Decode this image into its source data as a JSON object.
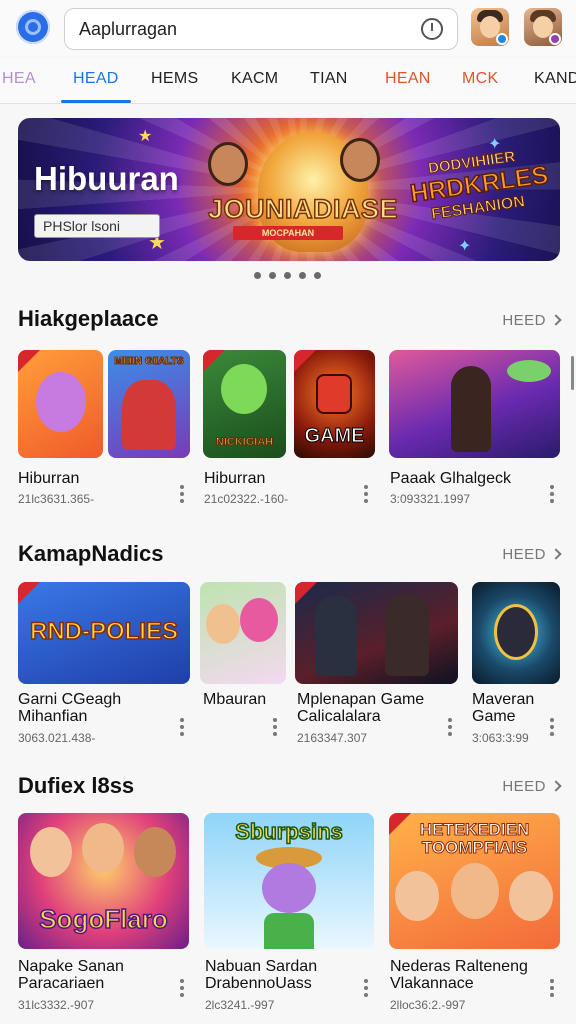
{
  "header": {
    "search_value": "Aaplurragan"
  },
  "tabs": [
    "HEA",
    "HEAD",
    "HEMS",
    "KACM",
    "TIAN",
    "HEAN",
    "MCK",
    "KAND"
  ],
  "hero": {
    "title": "Hibuuran",
    "chip": "PHSlor lsoni",
    "center_word": "JOUNIADIASE",
    "ribbon": "MOCPAHAN",
    "promo_line1": "DODVIHIIER",
    "promo_line2": "HRDKRLES",
    "promo_line3": "FESHANION",
    "carousel_count": 5
  },
  "sections": [
    {
      "title": "Hiakgeplaace",
      "more": "HEED",
      "cards": [
        {
          "art_label": "",
          "name": "Hiburran",
          "meta": "21lc3631.365-"
        },
        {
          "art_label": "MEIIN GIIALTS",
          "name": "",
          "meta": ""
        },
        {
          "art_label": "NICKIGIAH",
          "name": "Hiburran",
          "meta": "21c02322.-160-"
        },
        {
          "art_label": "GAME",
          "name": "",
          "meta": ""
        },
        {
          "art_label": "",
          "name": "Paaak Glhalgeck",
          "meta": "3:093321.1997"
        }
      ]
    },
    {
      "title": "KamapNadics",
      "more": "HEED",
      "cards": [
        {
          "art_label": "RND-POLIES",
          "name": "Garni CGeagh\nMihanfian",
          "meta": "3063.021.438-"
        },
        {
          "art_label": "",
          "name": "Mbauran",
          "meta": ""
        },
        {
          "art_label": "",
          "name": "Mplenapan Game\nCalicalalara",
          "meta": "2163347.307"
        },
        {
          "art_label": "",
          "name": "Maveran\nGame",
          "meta": "3:063:3:99"
        }
      ]
    },
    {
      "title": "Dufiex l8ss",
      "more": "HEED",
      "cards": [
        {
          "art_label": "SogoFlaro",
          "name": "Napake Sanan\nParacariaen",
          "meta": "31lc3332.-907"
        },
        {
          "art_label": "Sburpsins",
          "name": "Nabuan Sardan\nDrabennoUass",
          "meta": "2lc3241.-997"
        },
        {
          "art_label": "HETEKEDIEN TOOMPFIAIS",
          "name": "Nederas Ralteneng\nVlakannace",
          "meta": "2lloc36:2.-997"
        }
      ]
    }
  ]
}
